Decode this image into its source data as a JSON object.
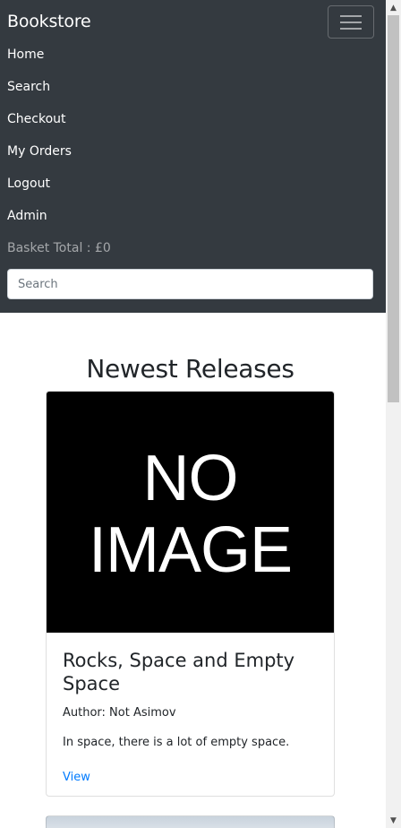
{
  "navbar": {
    "brand": "Bookstore",
    "items": [
      {
        "label": "Home"
      },
      {
        "label": "Search"
      },
      {
        "label": "Checkout"
      },
      {
        "label": "My Orders"
      },
      {
        "label": "Logout"
      },
      {
        "label": "Admin"
      }
    ],
    "basket_total": "Basket Total : £0",
    "search_placeholder": "Search",
    "background_color": "#343a40",
    "toggler_icon": "hamburger-icon"
  },
  "main": {
    "section_title": "Newest Releases",
    "books": [
      {
        "image_text_line1": "NO",
        "image_text_line2": "IMAGE",
        "title": "Rocks, Space and Empty Space",
        "author": "Author: Not Asimov",
        "description": "In space, there is a lot of empty space.",
        "link_label": "View"
      }
    ]
  },
  "colors": {
    "link": "#007bff",
    "accent_dark": "#343a40"
  }
}
